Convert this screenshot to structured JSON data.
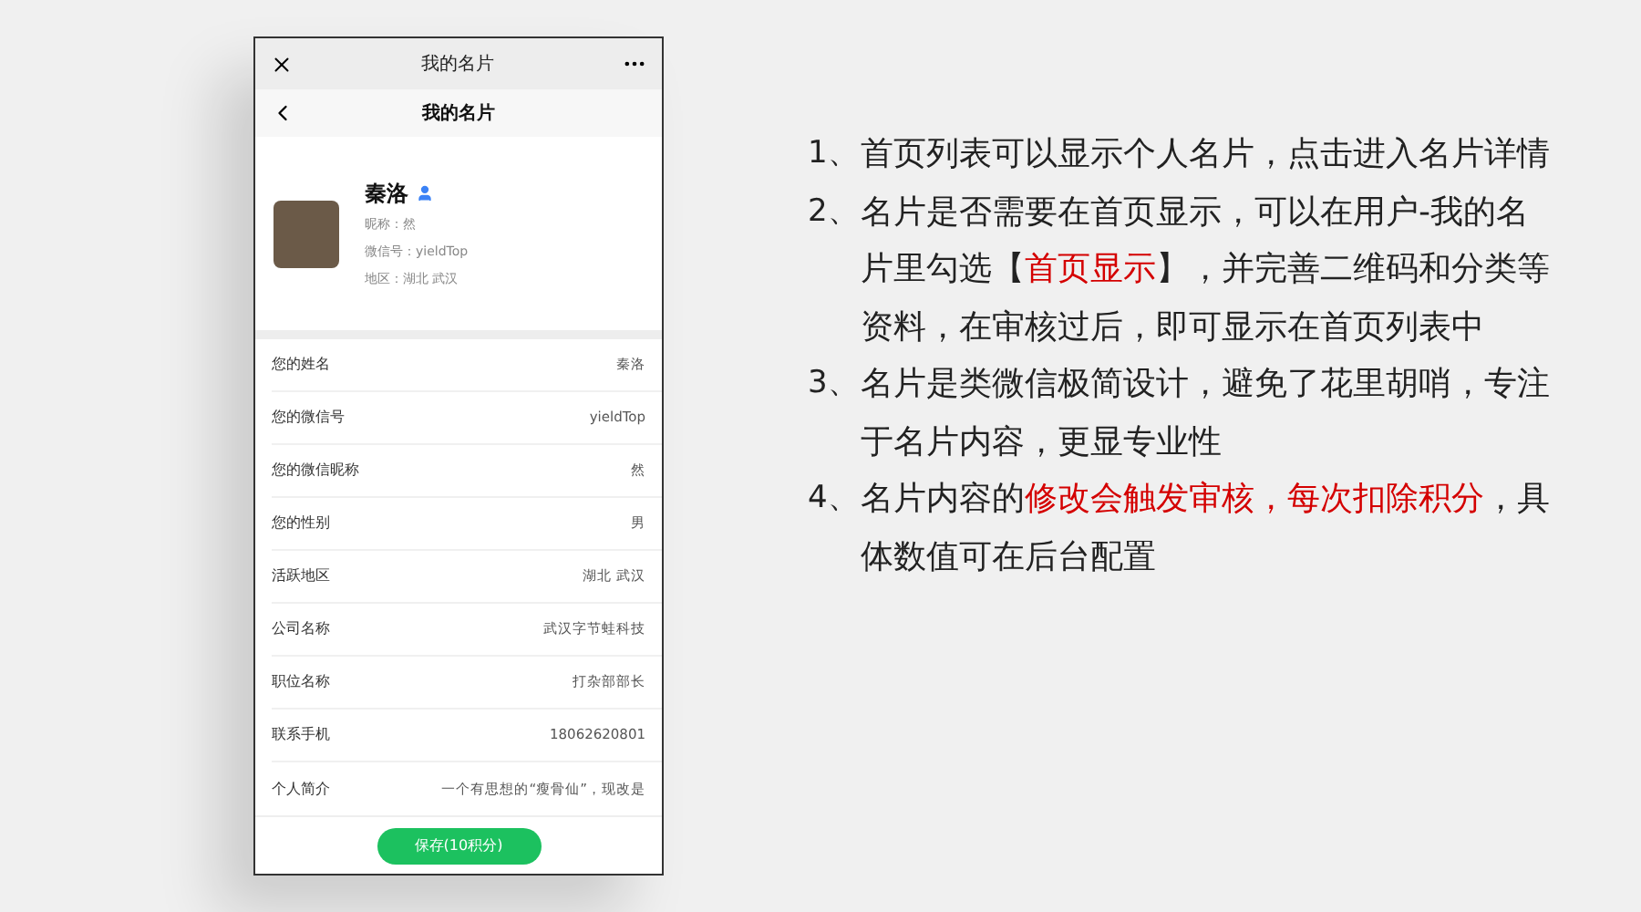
{
  "window": {
    "title": "我的名片"
  },
  "nav": {
    "title": "我的名片"
  },
  "profile": {
    "name": "秦洛",
    "verified": true,
    "details": [
      "昵称：然",
      "微信号：yieldTop",
      "地区：湖北 武汉"
    ]
  },
  "fields": [
    {
      "label": "您的姓名",
      "value": "秦洛"
    },
    {
      "label": "您的微信号",
      "value": "yieldTop"
    },
    {
      "label": "您的微信昵称",
      "value": "然"
    },
    {
      "label": "您的性别",
      "value": "男"
    },
    {
      "label": "活跃地区",
      "value": "湖北 武汉"
    },
    {
      "label": "公司名称",
      "value": "武汉字节蛙科技"
    },
    {
      "label": "职位名称",
      "value": "打杂部部长"
    },
    {
      "label": "联系手机",
      "value": "18062620801"
    },
    {
      "label": "个人简介",
      "value": "一个有思想的“瘦骨仙”，现改是"
    }
  ],
  "save_button": "保存(10积分)",
  "notes": [
    {
      "number": "1、",
      "segments": [
        {
          "text": "首页列表可以显示个人名片，点击进入名片详情",
          "emphasis": false
        }
      ]
    },
    {
      "number": "2、",
      "segments": [
        {
          "text": "名片是否需要在首页显示，可以在用户-我的名片里勾选【",
          "emphasis": false
        },
        {
          "text": "首页显示",
          "emphasis": true
        },
        {
          "text": "】，并完善二维码和分类等资料，在审核过后，即可显示在首页列表中",
          "emphasis": false
        }
      ]
    },
    {
      "number": "3、",
      "segments": [
        {
          "text": "名片是类微信极简设计，避免了花里胡哨，专注于名片内容，更显专业性",
          "emphasis": false
        }
      ]
    },
    {
      "number": "4、",
      "segments": [
        {
          "text": "名片内容的",
          "emphasis": false
        },
        {
          "text": "修改会触发审核，每次扣除积分",
          "emphasis": true
        },
        {
          "text": "，具体数值可在后台配置",
          "emphasis": false
        }
      ]
    }
  ]
}
